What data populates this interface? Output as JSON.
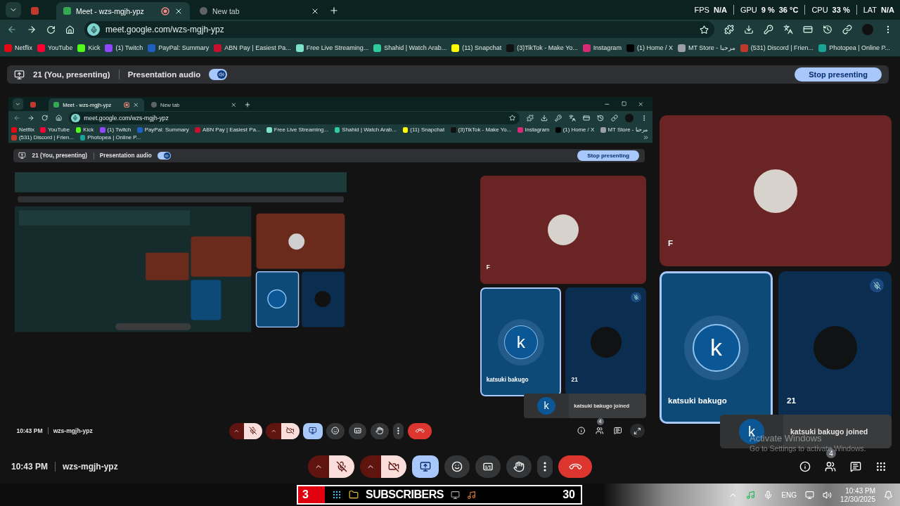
{
  "screen": {
    "tabs": [
      {
        "kind": "pinned",
        "selected": false
      },
      {
        "kind": "page",
        "title": "Meet - wzs-mgjh-ypz",
        "selected": true,
        "recording": true
      },
      {
        "kind": "page",
        "title": "New tab",
        "selected": false,
        "recording": false
      }
    ],
    "perf_overlay": [
      {
        "label": "FPS",
        "values": [
          "N/A"
        ]
      },
      {
        "label": "GPU",
        "values": [
          "9 %",
          "36 °C"
        ]
      },
      {
        "label": "CPU",
        "values": [
          "33 %"
        ]
      },
      {
        "label": "LAT",
        "values": [
          "N/A"
        ]
      }
    ],
    "address": "meet.google.com/wzs-mgjh-ypz",
    "bookmarks": [
      {
        "label": "Netflix",
        "color": "#e50914"
      },
      {
        "label": "YouTube",
        "color": "#ff0033"
      },
      {
        "label": "Kick",
        "color": "#53fc18"
      },
      {
        "label": "(1) Twitch",
        "color": "#9146ff"
      },
      {
        "label": "PayPal: Summary",
        "color": "#1f5fbf"
      },
      {
        "label": "ABN Pay | Easiest Pa...",
        "color": "#c8102e"
      },
      {
        "label": "Free Live Streaming...",
        "color": "#7ee2c8"
      },
      {
        "label": "Shahid | Watch Arab...",
        "color": "#2ecc9a"
      },
      {
        "label": "(11) Snapchat",
        "color": "#fffc00"
      },
      {
        "label": "(3)TikTok - Make Yo...",
        "color": "#111111"
      },
      {
        "label": "Instagram",
        "color": "#d62976"
      },
      {
        "label": "(1) Home / X",
        "color": "#000000"
      },
      {
        "label": "MT Store - مرحبا",
        "color": "#9aa0a6"
      },
      {
        "label": "(531) Discord | Frien...",
        "color": "#c0392b"
      },
      {
        "label": "Photopea | Online P...",
        "color": "#18a497"
      }
    ],
    "presenting_bar": {
      "label": "21 (You, presenting)",
      "audio_label": "Presentation audio",
      "audio_on": true,
      "stop_button": "Stop presenting"
    },
    "tiles": [
      {
        "kind": "photo",
        "name": "F",
        "color": "#6a2424",
        "speaking": false,
        "muted": false
      },
      {
        "kind": "letter",
        "letter": "k",
        "name": "katsuki bakugo",
        "color": "#0d4a78",
        "speaking": true,
        "muted": false
      },
      {
        "kind": "photo",
        "name": "21",
        "color": "#0a2d50",
        "speaking": false,
        "muted": true
      }
    ],
    "toast": {
      "letter": "k",
      "text": "katsuki bakugo joined"
    },
    "meeting_time": "10:43 PM",
    "meeting_code": "wzs-mgjh-ypz",
    "controls": [
      {
        "kind": "mic",
        "muted": true
      },
      {
        "kind": "camera",
        "off": true
      },
      {
        "kind": "present",
        "active": true
      },
      {
        "kind": "emoji"
      },
      {
        "kind": "captions"
      },
      {
        "kind": "hand"
      },
      {
        "kind": "more"
      },
      {
        "kind": "end"
      }
    ],
    "side_buttons": [
      {
        "kind": "info"
      },
      {
        "kind": "people",
        "badge": "4"
      },
      {
        "kind": "chat"
      },
      {
        "kind": "apps"
      }
    ],
    "os_watermark": {
      "title": "Activate Windows",
      "subtitle": "Go to Settings to activate Windows."
    },
    "shared_screen": {
      "window_controls": true,
      "tabs": [
        {
          "kind": "pinned",
          "selected": false
        },
        {
          "kind": "page",
          "title": "Meet - wzs-mgjh-ypz",
          "selected": true,
          "recording": true
        },
        {
          "kind": "page",
          "title": "New tab",
          "selected": false,
          "recording": false
        }
      ],
      "address": "meet.google.com/wzs-mgjh-ypz",
      "bookmarks": [
        {
          "label": "Netflix",
          "color": "#e50914"
        },
        {
          "label": "YouTube",
          "color": "#ff0033"
        },
        {
          "label": "Kick",
          "color": "#53fc18"
        },
        {
          "label": "(1) Twitch",
          "color": "#9146ff"
        },
        {
          "label": "PayPal: Summary",
          "color": "#1f5fbf"
        },
        {
          "label": "ABN Pay | Easiest Pa...",
          "color": "#c8102e"
        },
        {
          "label": "Free Live Streaming...",
          "color": "#7ee2c8"
        },
        {
          "label": "Shahid | Watch Arab...",
          "color": "#2ecc9a"
        },
        {
          "label": "(11) Snapchat",
          "color": "#fffc00"
        },
        {
          "label": "(3)TikTok - Make Yo...",
          "color": "#111111"
        },
        {
          "label": "Instagram",
          "color": "#d62976"
        },
        {
          "label": "(1) Home / X",
          "color": "#000000"
        },
        {
          "label": "MT Store - مرحبا",
          "color": "#9aa0a6"
        },
        {
          "label": "(531) Discord | Frien...",
          "color": "#c0392b"
        },
        {
          "label": "Photopea | Online P...",
          "color": "#18a497"
        }
      ],
      "presenting_bar": {
        "label": "21 (You, presenting)",
        "audio_label": "Presentation audio",
        "audio_on": true,
        "stop_button": "Stop presenting"
      },
      "tiles": [
        {
          "kind": "photo",
          "name": "F",
          "color": "#6a2424",
          "speaking": false,
          "muted": false
        },
        {
          "kind": "letter",
          "letter": "k",
          "name": "katsuki bakugo",
          "color": "#0d4a78",
          "speaking": true,
          "muted": false
        },
        {
          "kind": "photo",
          "name": "21",
          "color": "#0a2d50",
          "speaking": false,
          "muted": true
        }
      ],
      "toast": {
        "letter": "k",
        "text": "katsuki bakugo joined"
      },
      "meeting_time": "10:43 PM",
      "meeting_code": "wzs-mgjh-ypz",
      "controls": [
        {
          "kind": "mic",
          "muted": true
        },
        {
          "kind": "camera",
          "off": true
        },
        {
          "kind": "present",
          "active": true
        },
        {
          "kind": "emoji"
        },
        {
          "kind": "captions"
        },
        {
          "kind": "hand"
        },
        {
          "kind": "more"
        },
        {
          "kind": "end"
        }
      ],
      "side_buttons": [
        {
          "kind": "info"
        },
        {
          "kind": "people",
          "badge": "4"
        },
        {
          "kind": "chat"
        },
        {
          "kind": "fullscreen"
        }
      ]
    }
  },
  "taskbar": {
    "widget": {
      "count": "3",
      "label": "SUBSCRIBERS",
      "total": "30"
    },
    "tray": {
      "language": "ENG",
      "time": "10:43 PM",
      "date": "12/30/2025"
    }
  }
}
